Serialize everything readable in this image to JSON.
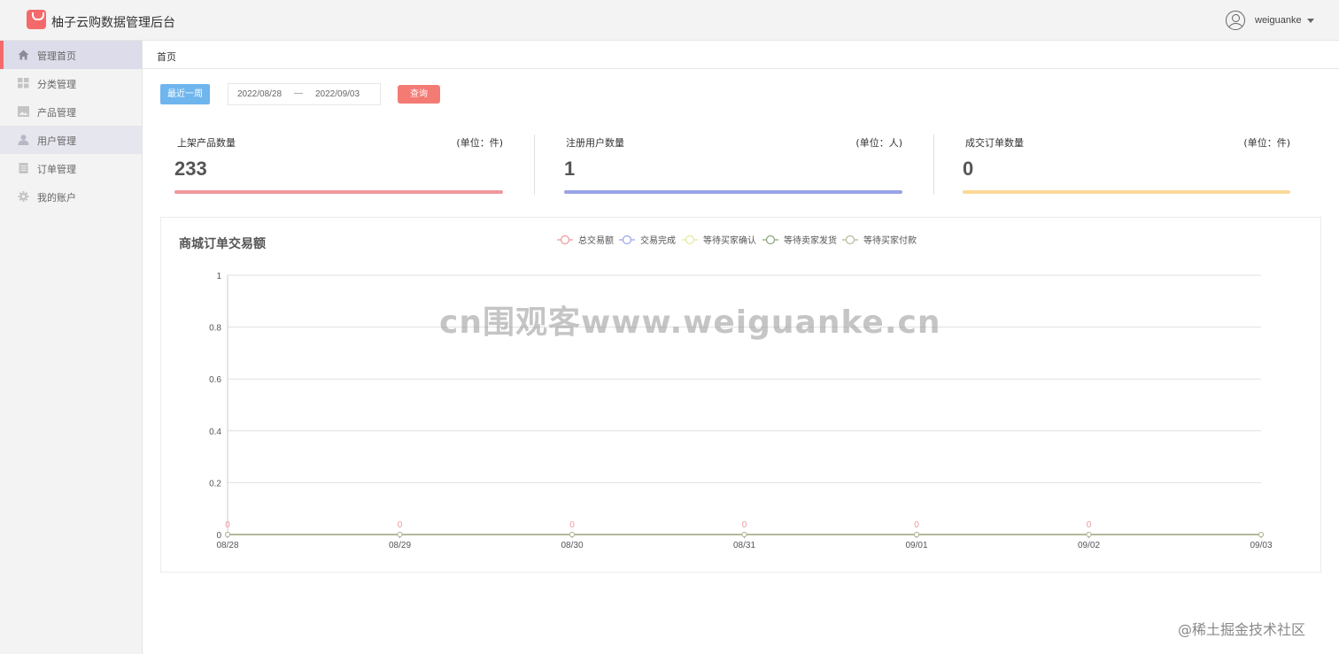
{
  "header": {
    "title": "柚子云购数据管理后台",
    "username": "weiguanke"
  },
  "sidebar": {
    "items": [
      {
        "label": "管理首页",
        "icon": "home-icon"
      },
      {
        "label": "分类管理",
        "icon": "grid-icon"
      },
      {
        "label": "产品管理",
        "icon": "image-icon"
      },
      {
        "label": "用户管理",
        "icon": "user-icon"
      },
      {
        "label": "订单管理",
        "icon": "document-icon"
      },
      {
        "label": "我的账户",
        "icon": "gear-icon"
      }
    ]
  },
  "breadcrumb": "首页",
  "filter": {
    "week_button": "最近一周",
    "start_date": "2022/08/28",
    "separator": "—",
    "end_date": "2022/09/03",
    "query_button": "查询"
  },
  "stats": [
    {
      "label": "上架产品数量",
      "unit": "(单位：件)",
      "value": "233",
      "color": "#f0989a"
    },
    {
      "label": "注册用户数量",
      "unit": "(单位：人)",
      "value": "1",
      "color": "#98a4e6"
    },
    {
      "label": "成交订单数量",
      "unit": "(单位：件)",
      "value": "0",
      "color": "#fcd898"
    }
  ],
  "chart_title": "商城订单交易额",
  "watermark": "cn围观客www.weiguanke.cn",
  "footer_mark": "@稀土掘金技术社区",
  "chart_data": {
    "type": "line",
    "title": "商城订单交易额",
    "x": [
      "08/28",
      "08/29",
      "08/30",
      "08/31",
      "09/01",
      "09/02",
      "09/03"
    ],
    "ylim": [
      0,
      1
    ],
    "yticks": [
      0,
      0.2,
      0.4,
      0.6,
      0.8,
      1
    ],
    "grid": true,
    "legend_position": "top-center",
    "series": [
      {
        "name": "总交易额",
        "color": "#f0989a",
        "values": [
          0,
          0,
          0,
          0,
          0,
          0,
          0
        ],
        "labels": true
      },
      {
        "name": "交易完成",
        "color": "#98a4e6",
        "values": [
          0,
          0,
          0,
          0,
          0,
          0,
          0
        ]
      },
      {
        "name": "等待买家确认",
        "color": "#e8e89a",
        "values": [
          0,
          0,
          0,
          0,
          0,
          0,
          0
        ]
      },
      {
        "name": "等待卖家发货",
        "color": "#8aa07a",
        "values": [
          0,
          0,
          0,
          0,
          0,
          0,
          0
        ]
      },
      {
        "name": "等待买家付款",
        "color": "#b8b89a",
        "values": [
          0,
          0,
          0,
          0,
          0,
          0,
          0
        ]
      }
    ]
  }
}
